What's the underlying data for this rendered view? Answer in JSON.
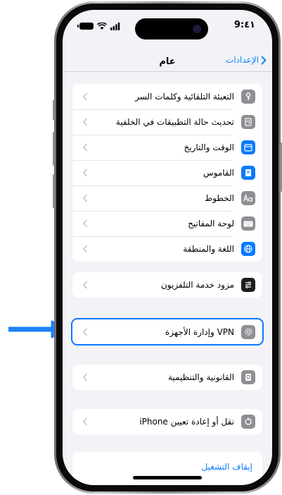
{
  "status_bar": {
    "time": "9:٤١"
  },
  "nav": {
    "title": "عام",
    "back_label": "الإعدادات"
  },
  "groups": {
    "main": [
      {
        "label": "التعبئة التلقائية وكلمات السر",
        "icon": "key-icon"
      },
      {
        "label": "تحديث حالة التطبيقات في الخلفية",
        "icon": "refresh-icon"
      },
      {
        "label": "الوقت والتاريخ",
        "icon": "calendar-clock-icon"
      },
      {
        "label": "القاموس",
        "icon": "book-icon"
      },
      {
        "label": "الخطوط",
        "icon": "fonts-icon"
      },
      {
        "label": "لوحة المفاتيح",
        "icon": "keyboard-icon"
      },
      {
        "label": "اللغة والمنطقة",
        "icon": "globe-icon"
      }
    ],
    "tv": {
      "label": "مزود خدمة التلفزيون",
      "icon": "tv-provider-icon"
    },
    "vpn": {
      "label": "VPN وإدارة الأجهزة",
      "icon": "gear-icon"
    },
    "legal": {
      "label": "القانونية والتنظيمية",
      "icon": "legal-icon"
    },
    "transfer": {
      "label": "نقل أو إعادة تعيين iPhone",
      "icon": "reset-icon"
    },
    "shutdown": {
      "label": "إيقاف التشغيل"
    }
  },
  "colors": {
    "accent": "#0a7aff",
    "background": "#f2f2f7",
    "arrow": "#1a82f7"
  }
}
